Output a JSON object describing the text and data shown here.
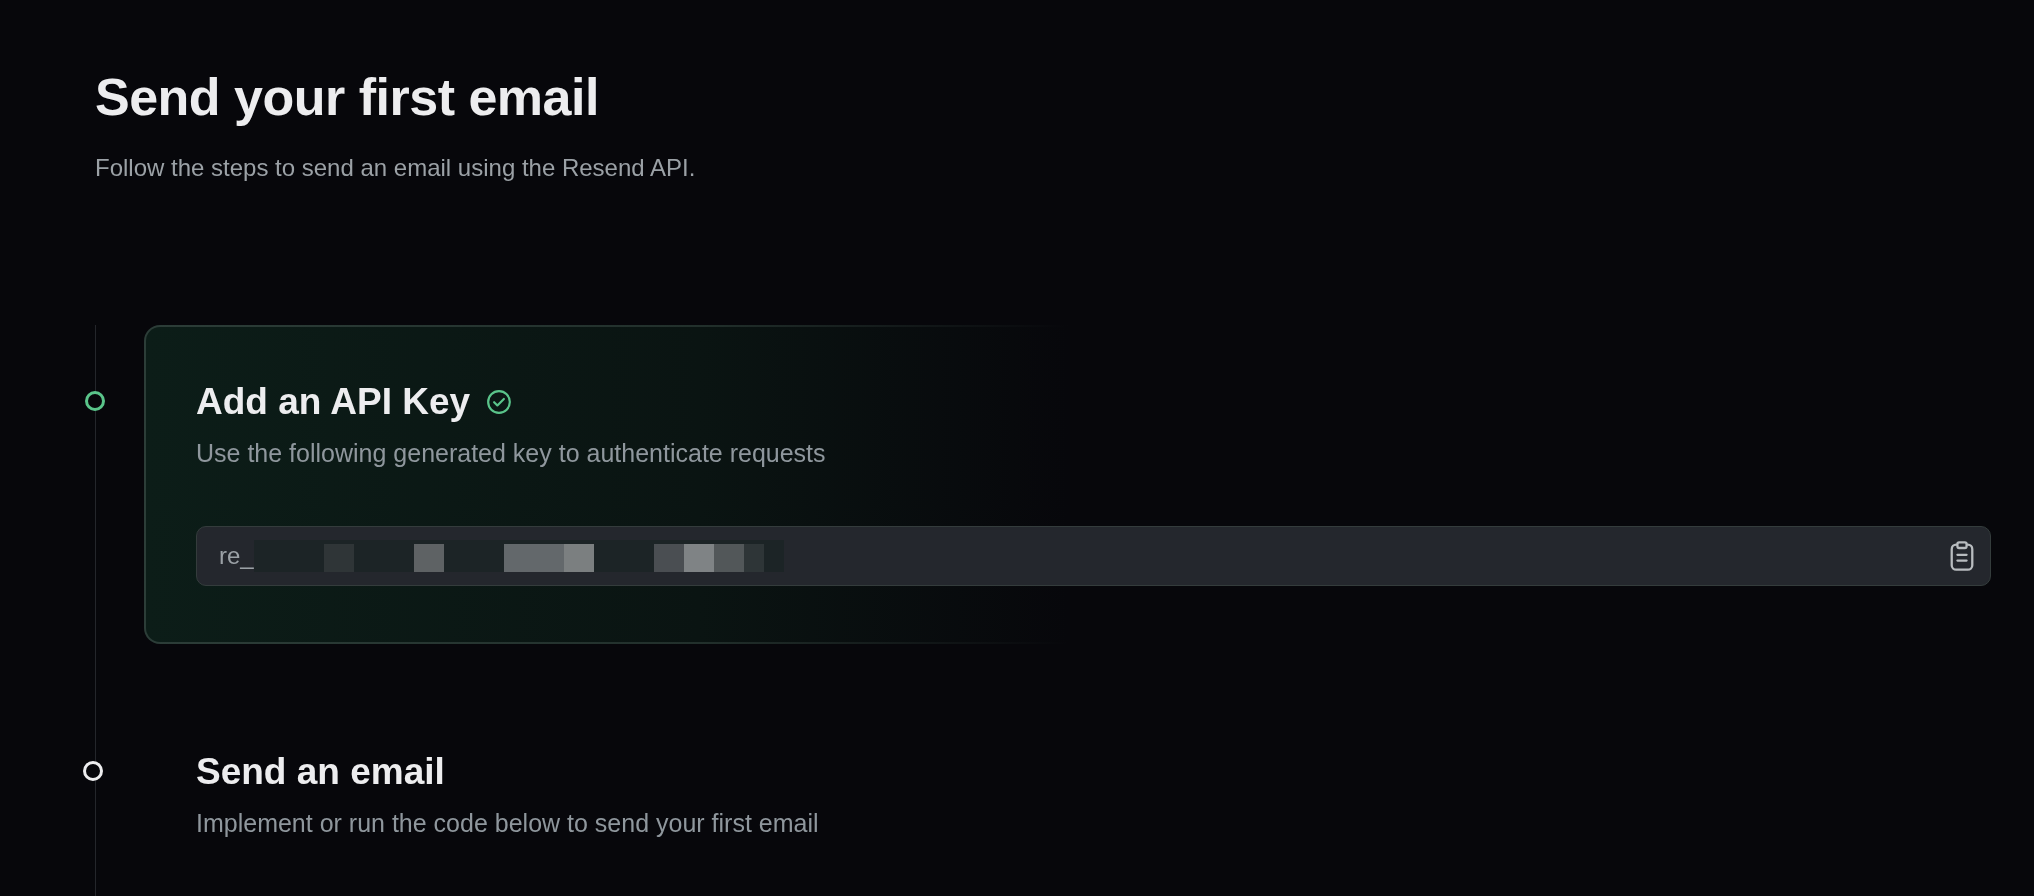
{
  "title": "Send your first email",
  "subtitle": "Follow the steps to send an email using the Resend API.",
  "steps": [
    {
      "title": "Add an API Key",
      "description": "Use the following generated key to authenticate requests",
      "completed": true,
      "expanded": true,
      "api_key": {
        "value": "re_"
      }
    },
    {
      "title": "Send an email",
      "description": "Implement or run the code below to send your first email",
      "completed": false,
      "expanded": false
    }
  ]
}
